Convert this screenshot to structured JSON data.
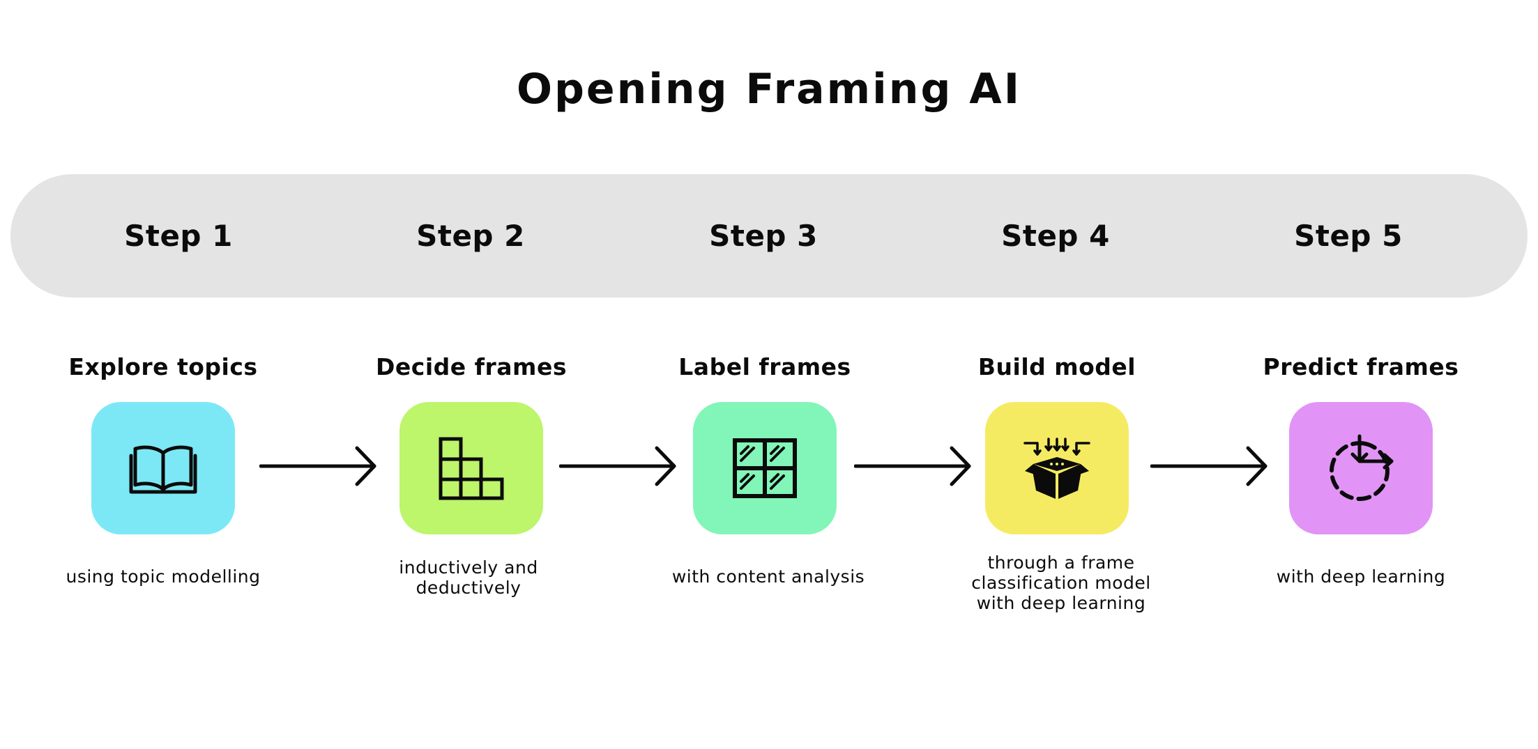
{
  "title": "Opening Framing AI",
  "steps": [
    {
      "step_label": "Step 1",
      "stage_title": "Explore topics",
      "caption": "using topic modelling",
      "icon": "open-book-icon",
      "color": "#7de8f5"
    },
    {
      "step_label": "Step 2",
      "stage_title": "Decide frames",
      "caption": "inductively and\ndeductively",
      "icon": "stacked-blocks-icon",
      "color": "#bdf56b"
    },
    {
      "step_label": "Step 3",
      "stage_title": "Label frames",
      "caption": "with content analysis",
      "icon": "window-grid-icon",
      "color": "#82f5b8"
    },
    {
      "step_label": "Step 4",
      "stage_title": "Build model",
      "caption": "through a frame\nclassification model\nwith deep learning",
      "icon": "box-inputs-icon",
      "color": "#f5eb63"
    },
    {
      "step_label": "Step 5",
      "stage_title": "Predict frames",
      "caption": "with deep learning",
      "icon": "dashed-cycle-icon",
      "color": "#e194f5"
    }
  ],
  "colors": {
    "bar": "#e4e4e4",
    "ink": "#0b0b0b",
    "background": "#ffffff"
  }
}
